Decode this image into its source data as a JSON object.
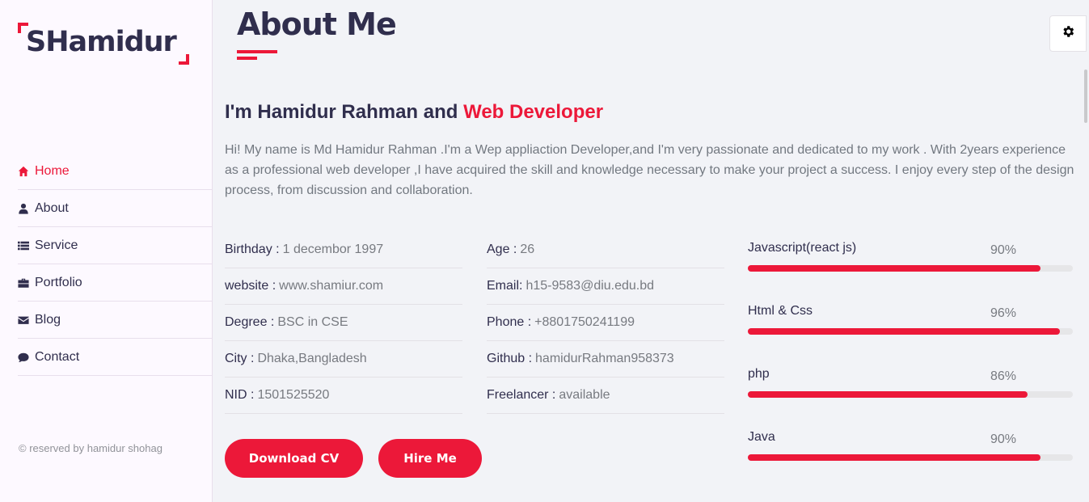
{
  "logo": {
    "text": "SHamidur"
  },
  "nav": {
    "items": [
      {
        "label": "Home",
        "icon": "home-icon",
        "active": true
      },
      {
        "label": "About",
        "icon": "user-icon"
      },
      {
        "label": "Service",
        "icon": "list-icon"
      },
      {
        "label": "Portfolio",
        "icon": "briefcase-icon"
      },
      {
        "label": "Blog",
        "icon": "envelope-icon"
      },
      {
        "label": "Contact",
        "icon": "comment-icon"
      }
    ]
  },
  "footer": {
    "copyright": "© reserved by hamidur shohag"
  },
  "about": {
    "title": "About Me",
    "intro_prefix": "I'm Hamidur Rahman and ",
    "intro_accent": "Web Developer",
    "description": "Hi! My name is Md Hamidur Rahman .I'm a Wep appliaction Developer,and I'm very passionate and dedicated to my work . With 2years experience as a professional web developer ,I have acquired the skill and knowledge necessary to make your project a success. I enjoy every step of the design process, from discussion and collaboration.",
    "info_left": [
      {
        "key": "Birthday :",
        "value": "1 decembor 1997"
      },
      {
        "key": "website :",
        "value": "www.shamiur.com"
      },
      {
        "key": "Degree :",
        "value": "BSC in CSE"
      },
      {
        "key": "City :",
        "value": "Dhaka,Bangladesh"
      },
      {
        "key": "NID :",
        "value": "1501525520"
      }
    ],
    "info_right": [
      {
        "key": "Age :",
        "value": "26"
      },
      {
        "key": "Email:",
        "value": "h15-9583@diu.edu.bd"
      },
      {
        "key": "Phone :",
        "value": "+8801750241199"
      },
      {
        "key": "Github :",
        "value": "hamidurRahman958373"
      },
      {
        "key": "Freelancer :",
        "value": "available"
      }
    ],
    "buttons": {
      "download_cv": "Download CV",
      "hire_me": "Hire Me"
    },
    "skills": [
      {
        "name": "Javascript(react js)",
        "percent_label": "90%",
        "level": 0.9
      },
      {
        "name": "Html & Css",
        "percent_label": "96%",
        "level": 0.96
      },
      {
        "name": "php",
        "percent_label": "86%",
        "level": 0.86
      },
      {
        "name": "Java",
        "percent_label": "90%",
        "level": 0.9
      }
    ]
  },
  "settings": {
    "icon": "gear-icon"
  },
  "colors": {
    "accent": "#ec1839",
    "text": "#302e4d",
    "muted": "#777a80",
    "sidebar_bg": "#fdf9ff",
    "page_bg": "#f2f3f7"
  }
}
